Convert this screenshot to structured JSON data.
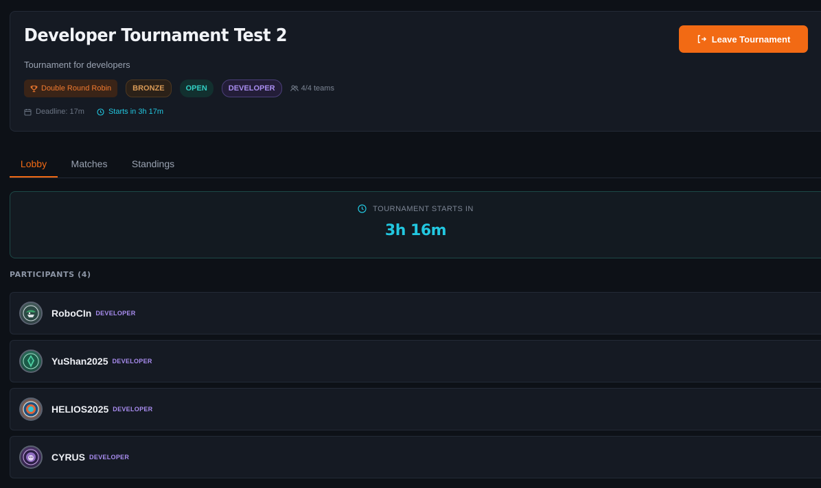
{
  "header": {
    "title": "Developer Tournament Test 2",
    "subtitle": "Tournament for developers",
    "leave_label": "Leave Tournament",
    "tags": {
      "format": "Double Round Robin",
      "tier": "BRONZE",
      "status": "OPEN",
      "category": "DEVELOPER",
      "teams": "4/4 teams"
    },
    "deadline": "Deadline: 17m",
    "starts": "Starts in 3h 17m"
  },
  "tabs": [
    {
      "label": "Lobby",
      "active": true
    },
    {
      "label": "Matches",
      "active": false
    },
    {
      "label": "Standings",
      "active": false
    }
  ],
  "countdown": {
    "label": "TOURNAMENT STARTS IN",
    "value": "3h 16m"
  },
  "participants": {
    "heading": "PARTICIPANTS (4)",
    "items": [
      {
        "name": "RoboCIn",
        "role": "DEVELOPER",
        "avatar_icon": "robot-team-icon"
      },
      {
        "name": "YuShan2025",
        "role": "DEVELOPER",
        "avatar_icon": "emerald-crest-icon"
      },
      {
        "name": "HELIOS2025",
        "role": "DEVELOPER",
        "avatar_icon": "sun-orb-icon"
      },
      {
        "name": "CYRUS",
        "role": "DEVELOPER",
        "avatar_icon": "lion-crest-icon"
      }
    ]
  },
  "colors": {
    "accent": "#f26a14",
    "cyan": "#22c7e0",
    "purple": "#a98df0",
    "background": "#0d1117",
    "card": "#151a23"
  }
}
